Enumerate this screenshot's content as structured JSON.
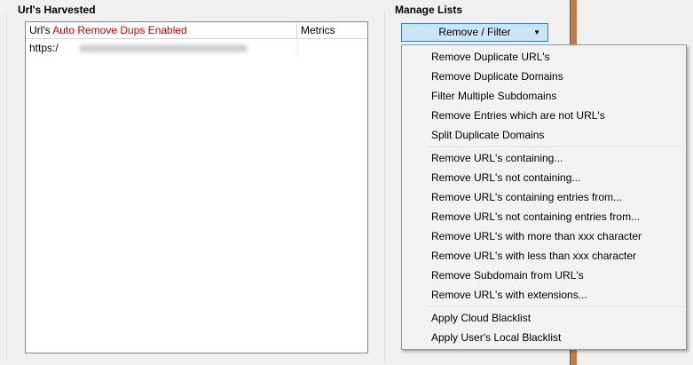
{
  "harvested": {
    "title": "Url's Harvested",
    "col_url_prefix": "Url's",
    "col_url_suffix": "Auto Remove Dups Enabled",
    "col_metrics": "Metrics",
    "rows": [
      {
        "url": "https:/"
      }
    ]
  },
  "manage": {
    "title": "Manage Lists",
    "button": "Remove / Filter"
  },
  "menu": {
    "items": [
      "Remove Duplicate URL's",
      "Remove Duplicate Domains",
      "Filter Multiple Subdomains",
      "Remove Entries which are not URL's",
      "Split Duplicate Domains",
      "Remove URL's containing...",
      "Remove URL's not containing...",
      "Remove URL's containing entries from...",
      "Remove URL's not containing entries from...",
      "Remove URL's with more than xxx character",
      "Remove URL's with less than xxx character",
      "Remove Subdomain from URL's",
      "Remove URL's with extensions...",
      "Apply Cloud Blacklist",
      "Apply User's Local Blacklist"
    ]
  },
  "colors": {
    "accent_red": "#d40000",
    "button_bg": "#cce4f7",
    "button_border": "#3c7fb1"
  },
  "icons": {
    "dropdown": "triangle-down"
  }
}
